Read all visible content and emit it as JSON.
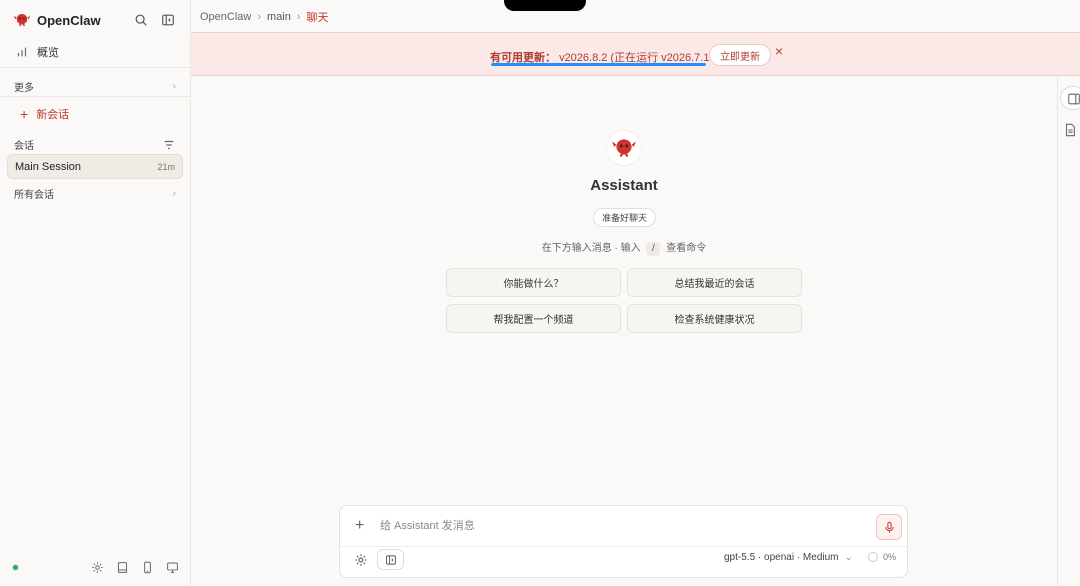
{
  "app": {
    "name": "OpenClaw"
  },
  "sidebar": {
    "overview_label": "概览",
    "more_label": "更多",
    "new_chat_label": "新会话",
    "sessions_label": "会话",
    "active_session": {
      "title": "Main Session",
      "age": "21m"
    },
    "all_sessions_label": "所有会话"
  },
  "breadcrumb": {
    "root": "OpenClaw",
    "agent": "main",
    "current": "聊天"
  },
  "banner": {
    "title": "有可用更新：",
    "detail": "v2026.8.2 (正在运行 v2026.7.1-2).",
    "button_label": "立即更新",
    "close_glyph": "×",
    "progress": 1.0
  },
  "main": {
    "assistant_name": "Assistant",
    "status_badge": "准备好聊天",
    "hint_before": "在下方输入消息 · 输入",
    "hint_key": "/",
    "hint_after": "查看命令",
    "suggestions": [
      "你能做什么？",
      "总结我最近的会话",
      "帮我配置一个频道",
      "检查系统健康状况"
    ]
  },
  "composer": {
    "placeholder": "给 Assistant 发消息",
    "model_label": "gpt-5.5 · openai · Medium",
    "context_usage": "0%"
  },
  "colors": {
    "accent": "#c0392b",
    "banner_bg": "#fbe9e8",
    "progress": "#1e90ff",
    "status_ok": "#27ae60"
  }
}
